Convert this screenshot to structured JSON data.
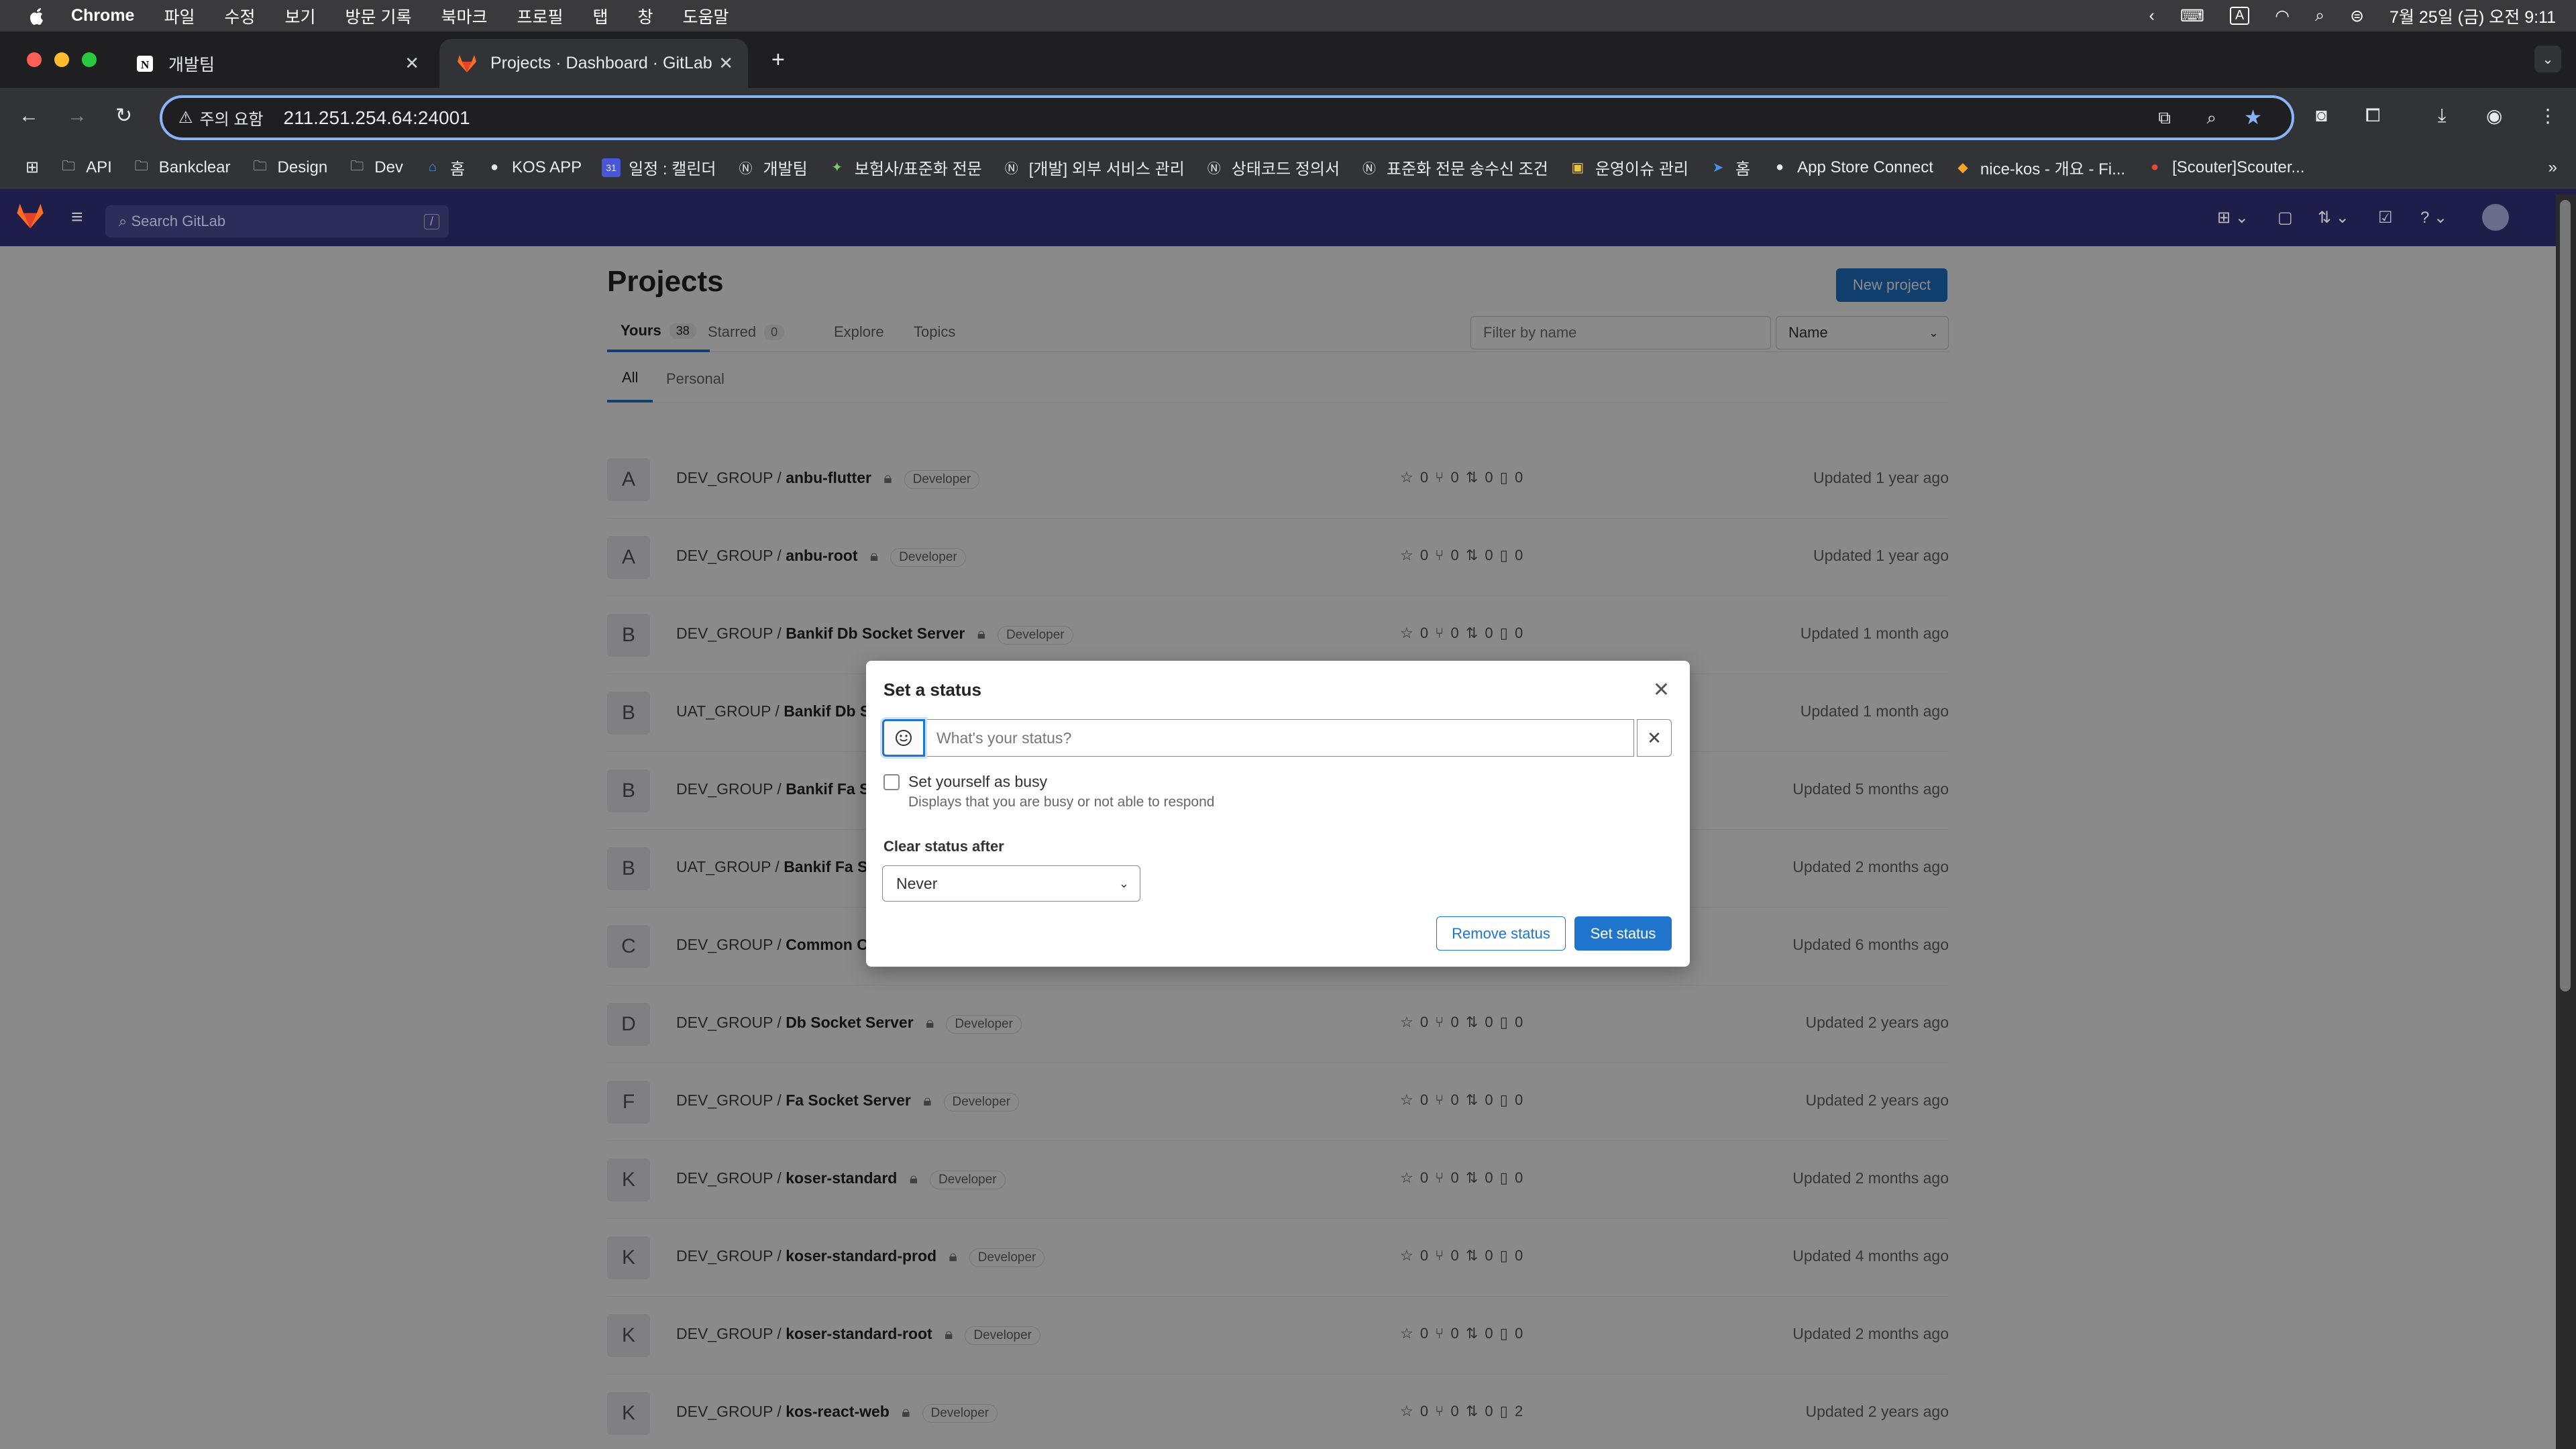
{
  "menubar": {
    "app": "Chrome",
    "items": [
      "파일",
      "수정",
      "보기",
      "방문 기록",
      "북마크",
      "프로필",
      "탭",
      "창",
      "도움말"
    ],
    "clock": "7월 25일 (금) 오전 9:11"
  },
  "tabs": [
    {
      "title": "개발팀"
    },
    {
      "title": "Projects · Dashboard · GitLab"
    }
  ],
  "omnibox": {
    "warning": "주의 요함",
    "url": "211.251.254.64:24001"
  },
  "bookmarks": [
    {
      "label": "API",
      "icon": "folder-icon"
    },
    {
      "label": "Bankclear",
      "icon": "folder-icon"
    },
    {
      "label": "Design",
      "icon": "folder-icon"
    },
    {
      "label": "Dev",
      "icon": "folder-icon"
    },
    {
      "label": "홈",
      "icon": "home-icon"
    },
    {
      "label": "KOS APP",
      "icon": "app-icon"
    },
    {
      "label": "일정 : 캘린더",
      "icon": "calendar-icon"
    },
    {
      "label": "개발팀",
      "icon": "notion-icon"
    },
    {
      "label": "보험사/표준화 전문",
      "icon": "puzzle-icon"
    },
    {
      "label": "[개발] 외부 서비스 관리",
      "icon": "notion-icon"
    },
    {
      "label": "상태코드 정의서",
      "icon": "notion-icon"
    },
    {
      "label": "표준화 전문 송수신 조건",
      "icon": "notion-icon"
    },
    {
      "label": "운영이슈 관리",
      "icon": "image-icon"
    },
    {
      "label": "홈",
      "icon": "home-icon"
    },
    {
      "label": "App Store Connect",
      "icon": "apple-icon"
    },
    {
      "label": "nice-kos - 개요 - Fi...",
      "icon": "firebase-icon"
    },
    {
      "label": "[Scouter]Scouter...",
      "icon": "scouter-icon"
    }
  ],
  "gitlab": {
    "search_placeholder": "Search GitLab",
    "search_shortcut": "/",
    "page_title": "Projects",
    "new_project": "New project",
    "tabs": [
      {
        "label": "Yours",
        "count": "38"
      },
      {
        "label": "Starred",
        "count": "0"
      },
      {
        "label": "Explore",
        "count": ""
      },
      {
        "label": "Topics",
        "count": ""
      }
    ],
    "filter_placeholder": "Filter by name",
    "sort": "Name",
    "subtabs": [
      "All",
      "Personal"
    ],
    "projects": [
      {
        "avatar": "A",
        "group": "DEV_GROUP / ",
        "name": "anbu-flutter",
        "role": "Developer",
        "stats": "☆ 0  ⑂ 0  ⇅ 0  ▯ 0",
        "updated": "Updated 1 year ago"
      },
      {
        "avatar": "A",
        "group": "DEV_GROUP / ",
        "name": "anbu-root",
        "role": "Developer",
        "stats": "☆ 0  ⑂ 0  ⇅ 0  ▯ 0",
        "updated": "Updated 1 year ago"
      },
      {
        "avatar": "B",
        "group": "DEV_GROUP / ",
        "name": "Bankif Db Socket Server",
        "role": "Developer",
        "stats": "☆ 0  ⑂ 0  ⇅ 0  ▯ 0",
        "updated": "Updated 1 month ago"
      },
      {
        "avatar": "B",
        "group": "UAT_GROUP / ",
        "name": "Bankif Db So",
        "role": "",
        "stats": "",
        "updated": "Updated 1 month ago"
      },
      {
        "avatar": "B",
        "group": "DEV_GROUP / ",
        "name": "Bankif Fa So",
        "role": "",
        "stats": "",
        "updated": "Updated 5 months ago"
      },
      {
        "avatar": "B",
        "group": "UAT_GROUP / ",
        "name": "Bankif Fa So",
        "role": "",
        "stats": "",
        "updated": "Updated 2 months ago"
      },
      {
        "avatar": "C",
        "group": "DEV_GROUP / ",
        "name": "Common Co",
        "role": "",
        "stats": "",
        "updated": "Updated 6 months ago"
      },
      {
        "avatar": "D",
        "group": "DEV_GROUP / ",
        "name": "Db Socket Server",
        "role": "Developer",
        "stats": "☆ 0  ⑂ 0  ⇅ 0  ▯ 0",
        "updated": "Updated 2 years ago"
      },
      {
        "avatar": "F",
        "group": "DEV_GROUP / ",
        "name": "Fa Socket Server",
        "role": "Developer",
        "stats": "☆ 0  ⑂ 0  ⇅ 0  ▯ 0",
        "updated": "Updated 2 years ago"
      },
      {
        "avatar": "K",
        "group": "DEV_GROUP / ",
        "name": "koser-standard",
        "role": "Developer",
        "stats": "☆ 0  ⑂ 0  ⇅ 0  ▯ 0",
        "updated": "Updated 2 months ago"
      },
      {
        "avatar": "K",
        "group": "DEV_GROUP / ",
        "name": "koser-standard-prod",
        "role": "Developer",
        "stats": "☆ 0  ⑂ 0  ⇅ 0  ▯ 0",
        "updated": "Updated 4 months ago"
      },
      {
        "avatar": "K",
        "group": "DEV_GROUP / ",
        "name": "koser-standard-root",
        "role": "Developer",
        "stats": "☆ 0  ⑂ 0  ⇅ 0  ▯ 0",
        "updated": "Updated 2 months ago"
      },
      {
        "avatar": "K",
        "group": "DEV_GROUP / ",
        "name": "kos-react-web",
        "role": "Developer",
        "stats": "☆ 0  ⑂ 0  ⇅ 0  ▯ 2",
        "updated": "Updated 2 years ago"
      }
    ]
  },
  "modal": {
    "title": "Set a status",
    "status_placeholder": "What's your status?",
    "busy_label": "Set yourself as busy",
    "busy_help": "Displays that you are busy or not able to respond",
    "clear_after_label": "Clear status after",
    "clear_after_value": "Never",
    "remove_button": "Remove status",
    "set_button": "Set status"
  },
  "colors": {
    "gitlab_nav": "#1f1e4a",
    "primary": "#1f75cb",
    "omnibox_focus": "#8ab4f8"
  }
}
